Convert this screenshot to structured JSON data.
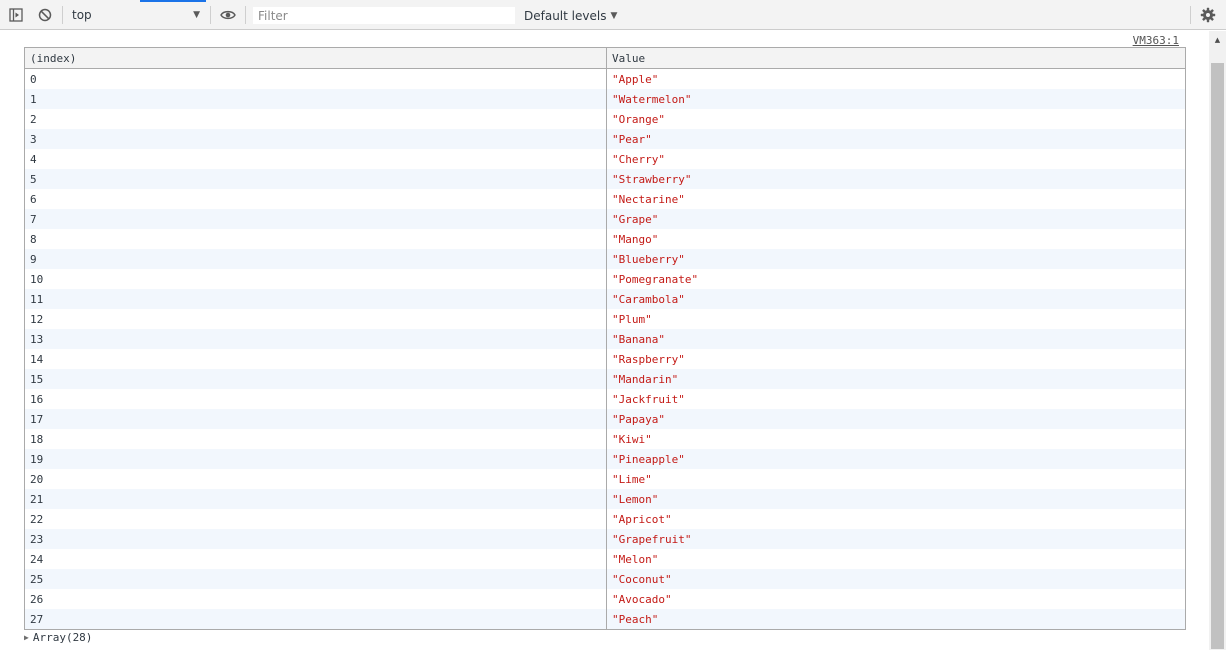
{
  "toolbar": {
    "context": "top",
    "filter_placeholder": "Filter",
    "filter_value": "",
    "levels": "Default levels"
  },
  "console": {
    "source_link": "VM363:1",
    "table": {
      "headers": [
        "(index)",
        "Value"
      ],
      "rows": [
        {
          "index": "0",
          "value": "\"Apple\""
        },
        {
          "index": "1",
          "value": "\"Watermelon\""
        },
        {
          "index": "2",
          "value": "\"Orange\""
        },
        {
          "index": "3",
          "value": "\"Pear\""
        },
        {
          "index": "4",
          "value": "\"Cherry\""
        },
        {
          "index": "5",
          "value": "\"Strawberry\""
        },
        {
          "index": "6",
          "value": "\"Nectarine\""
        },
        {
          "index": "7",
          "value": "\"Grape\""
        },
        {
          "index": "8",
          "value": "\"Mango\""
        },
        {
          "index": "9",
          "value": "\"Blueberry\""
        },
        {
          "index": "10",
          "value": "\"Pomegranate\""
        },
        {
          "index": "11",
          "value": "\"Carambola\""
        },
        {
          "index": "12",
          "value": "\"Plum\""
        },
        {
          "index": "13",
          "value": "\"Banana\""
        },
        {
          "index": "14",
          "value": "\"Raspberry\""
        },
        {
          "index": "15",
          "value": "\"Mandarin\""
        },
        {
          "index": "16",
          "value": "\"Jackfruit\""
        },
        {
          "index": "17",
          "value": "\"Papaya\""
        },
        {
          "index": "18",
          "value": "\"Kiwi\""
        },
        {
          "index": "19",
          "value": "\"Pineapple\""
        },
        {
          "index": "20",
          "value": "\"Lime\""
        },
        {
          "index": "21",
          "value": "\"Lemon\""
        },
        {
          "index": "22",
          "value": "\"Apricot\""
        },
        {
          "index": "23",
          "value": "\"Grapefruit\""
        },
        {
          "index": "24",
          "value": "\"Melon\""
        },
        {
          "index": "25",
          "value": "\"Coconut\""
        },
        {
          "index": "26",
          "value": "\"Avocado\""
        },
        {
          "index": "27",
          "value": "\"Peach\""
        }
      ]
    },
    "array_summary": "Array(28)"
  },
  "icons": {
    "sidebar_toggle": "sidebar-toggle-icon",
    "clear": "clear-console-icon",
    "eye": "eye-icon",
    "settings": "gear-icon"
  },
  "colors": {
    "string_value": "#c41a16",
    "accent": "#1a73e8"
  }
}
